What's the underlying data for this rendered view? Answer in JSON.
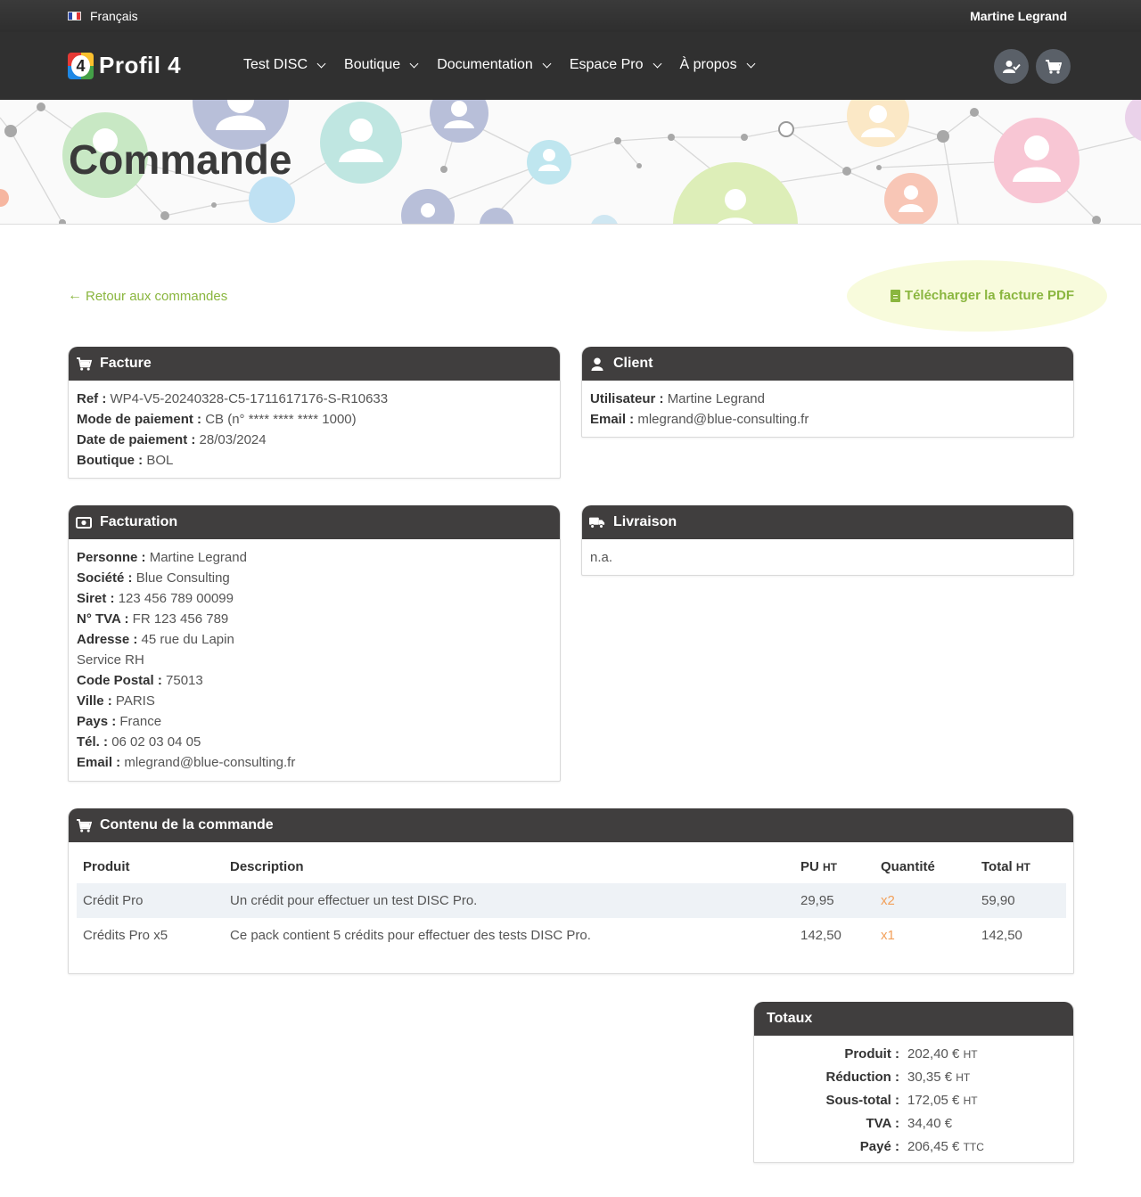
{
  "topbar": {
    "language": "Français",
    "user": "Martine Legrand"
  },
  "brand": {
    "logo_number": "4",
    "name": "Profil 4"
  },
  "nav": {
    "items": [
      "Test DISC",
      "Boutique",
      "Documentation",
      "Espace Pro",
      "À propos"
    ]
  },
  "banner": {
    "title": "Commande"
  },
  "actions": {
    "back": "Retour aux commandes",
    "pdf": "Télécharger la facture PDF"
  },
  "facture": {
    "title": "Facture",
    "ref_label": "Ref :",
    "ref": "WP4-V5-20240328-C5-1711617176-S-R10633",
    "mode_label": "Mode de paiement :",
    "mode": "CB (n° **** **** **** 1000)",
    "date_label": "Date de paiement :",
    "date": "28/03/2024",
    "boutique_label": "Boutique :",
    "boutique": "BOL"
  },
  "client": {
    "title": "Client",
    "user_label": "Utilisateur :",
    "user": "Martine Legrand",
    "email_label": "Email :",
    "email": "mlegrand@blue-consulting.fr"
  },
  "facturation": {
    "title": "Facturation",
    "personne_label": "Personne :",
    "personne": "Martine Legrand",
    "societe_label": "Société :",
    "societe": "Blue Consulting",
    "siret_label": "Siret :",
    "siret": "123 456 789 00099",
    "tva_label": "N° TVA :",
    "tva": "FR 123 456 789",
    "adresse_label": "Adresse :",
    "adresse": "45 rue du Lapin",
    "adresse2": "Service RH",
    "cp_label": "Code Postal :",
    "cp": "75013",
    "ville_label": "Ville :",
    "ville": "PARIS",
    "pays_label": "Pays :",
    "pays": "France",
    "tel_label": "Tél. :",
    "tel": "06 02 03 04 05",
    "email_label": "Email :",
    "email": "mlegrand@blue-consulting.fr"
  },
  "livraison": {
    "title": "Livraison",
    "value": "n.a."
  },
  "contenu": {
    "title": "Contenu de la commande",
    "headers": {
      "produit": "Produit",
      "description": "Description",
      "pu": "PU",
      "pu_unit": "HT",
      "quantite": "Quantité",
      "total": "Total",
      "total_unit": "HT"
    },
    "rows": [
      {
        "produit": "Crédit Pro",
        "description": "Un crédit pour effectuer un test DISC Pro.",
        "pu": "29,95",
        "qty": "x2",
        "total": "59,90"
      },
      {
        "produit": "Crédits Pro x5",
        "description": "Ce pack contient 5 crédits pour effectuer des tests DISC Pro.",
        "pu": "142,50",
        "qty": "x1",
        "total": "142,50"
      }
    ]
  },
  "totaux": {
    "title": "Totaux",
    "rows": [
      {
        "label": "Produit :",
        "value": "202,40 €",
        "unit": "HT"
      },
      {
        "label": "Réduction :",
        "value": "30,35 €",
        "unit": "HT"
      },
      {
        "label": "Sous-total :",
        "value": "172,05 €",
        "unit": "HT"
      },
      {
        "label": "TVA :",
        "value": "34,40 €",
        "unit": ""
      },
      {
        "label": "Payé :",
        "value": "206,45 €",
        "unit": "TTC"
      }
    ]
  },
  "colors": {
    "accent": "#8ab63f",
    "header": "#403e3e",
    "navbar": "#303030",
    "qty": "#f2a05a"
  },
  "icons": [
    "france-flag-icon",
    "user-check-icon",
    "cart-icon",
    "user-icon",
    "money-icon",
    "truck-icon",
    "file-pdf-icon",
    "arrow-left-icon"
  ]
}
